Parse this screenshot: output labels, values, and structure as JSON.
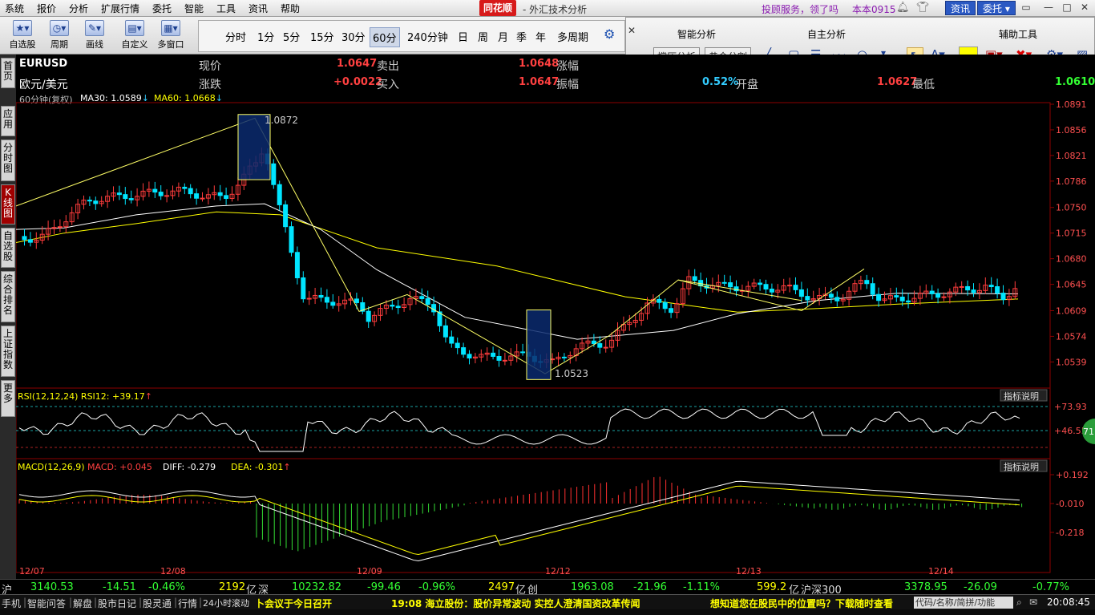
{
  "menu": {
    "items": [
      "系统",
      "报价",
      "分析",
      "扩展行情",
      "委托",
      "智能",
      "工具",
      "资讯",
      "帮助"
    ],
    "brand": "同花顺",
    "window_title": "- 外汇技术分析",
    "promo": "投顾服务，领了吗",
    "version": "本本0915",
    "btn_news": "资讯",
    "btn_trade": "委托"
  },
  "toolbar": {
    "buttons": [
      "自选股",
      "周期",
      "画线",
      "自定义",
      "多窗口"
    ],
    "periods": [
      "分时",
      "1分",
      "5分",
      "15分",
      "30分",
      "60分",
      "240分钟",
      "日",
      "周",
      "月",
      "季",
      "年",
      "多周期"
    ],
    "selected_period": "60分"
  },
  "analysis": {
    "h1": "智能分析",
    "h2": "自主分析",
    "h3": "辅助工具",
    "btn1": "撑压分析",
    "btn2": "黄金分割"
  },
  "sidetabs": [
    "首页",
    "应用",
    "分时图",
    "K线图",
    "自选股",
    "综合排名",
    "上证指数",
    "更多"
  ],
  "quote": {
    "symbol": "EURUSD",
    "name": "欧元/美元",
    "l_price": "现价",
    "price": "1.0647",
    "l_sell": "卖出",
    "sell": "1.0648",
    "l_rise": "涨幅",
    "l_change": "涨跌",
    "change": "+0.0022",
    "l_buy": "买入",
    "buy": "1.0647",
    "l_amp": "振幅",
    "amp": "0.52%",
    "l_open": "开盘",
    "open": "1.0627",
    "l_low": "最低",
    "low": "1.0610",
    "ma_line": "60分钟(复权)",
    "ma30": "MA30: 1.0589",
    "ma60": "MA60: 1.0668"
  },
  "chart_data": {
    "type": "candlestick",
    "y_ticks": [
      "1.0891",
      "1.0856",
      "1.0821",
      "1.0786",
      "1.0750",
      "1.0715",
      "1.0680",
      "1.0645",
      "1.0609",
      "1.0574",
      "1.0539"
    ],
    "x_labels": [
      "12/07",
      "12/08",
      "12/09",
      "12/12",
      "12/13",
      "12/14"
    ],
    "high_label": "1.0872",
    "low_label": "1.0523",
    "rsi_title": "RSI(12,12,24) RSI12: +39.17",
    "rsi_ticks": [
      "+73.93",
      "+46.55"
    ],
    "rsi_badge": "71",
    "macd_title": "MACD(12,26,9)",
    "macd_val": "MACD: +0.045",
    "diff": "DIFF: -0.279",
    "dea": "DEA: -0.301",
    "macd_ticks": [
      "+0.192",
      "-0.010",
      "-0.218"
    ],
    "indicator_btn": "指标说明",
    "colors": {
      "up": "#ff3c3c",
      "down": "#00e5ff",
      "ma30": "#ffffff",
      "ma60": "#ffff00",
      "grid": "#8b0000"
    }
  },
  "status": {
    "sh_label": "沪",
    "sh_val": "3140.53",
    "sh_chg": "-14.51",
    "sh_pct": "-0.46%",
    "sh_amt": "2192",
    "sh_unit": "亿",
    "sz_label": "深",
    "sz_val": "10232.82",
    "sz_chg": "-99.46",
    "sz_pct": "-0.96%",
    "sz_amt": "2497",
    "sz_unit": "亿",
    "cy_label": "创",
    "cy_val": "1963.08",
    "cy_chg": "-21.96",
    "cy_pct": "-1.11%",
    "cy_amt": "599.2",
    "cy_unit": "亿",
    "hs_label": "沪深300",
    "hs_val": "3378.95",
    "hs_chg": "-26.09",
    "hs_pct": "-0.77%"
  },
  "footer": {
    "items": [
      "手机",
      "智能问答",
      "解盘",
      "股市日记",
      "股灵通",
      "行情",
      "24小时滚动"
    ],
    "ticker1": "卜会议于今日召开",
    "ticker2": "19:08 海立股份：股价异常波动 实控人澄清国资改革传闻",
    "ticker3": "想知道您在股民中的位置吗？下载随时查看",
    "search": "代码/名称/简拼/功能",
    "time": "20:08:45"
  }
}
